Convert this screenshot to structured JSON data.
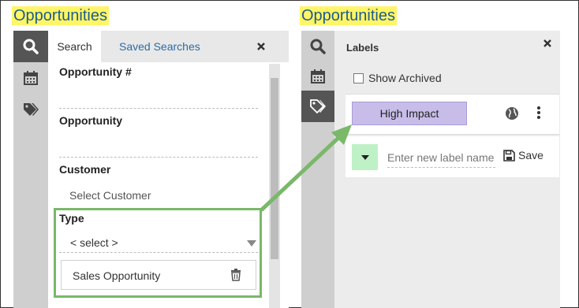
{
  "colors": {
    "heading_bg": "#fff566",
    "heading_text": "#1f5c8b",
    "highlight_green": "#7ab86a",
    "label_purple": "#c8bde8",
    "color_picker_green": "#bff1c6",
    "link_blue": "#2b6ca8"
  },
  "left": {
    "heading": "Opportunities",
    "rail": [
      {
        "icon": "search-icon",
        "active": true
      },
      {
        "icon": "calendar-icon",
        "active": false
      },
      {
        "icon": "tags-icon",
        "active": false
      }
    ],
    "tabs": {
      "search": "Search",
      "saved": "Saved Searches",
      "close_icon": "close-icon"
    },
    "fields": {
      "opportunity_number": "Opportunity #",
      "opportunity": "Opportunity",
      "customer": "Customer",
      "customer_placeholder": "Select Customer",
      "type": "Type",
      "type_selected": "< select >",
      "type_chip": "Sales Opportunity"
    }
  },
  "right": {
    "heading": "Opportunities",
    "rail": [
      {
        "icon": "search-icon",
        "active": false
      },
      {
        "icon": "calendar-icon",
        "active": false
      },
      {
        "icon": "tags-icon",
        "active": true
      }
    ],
    "title": "Labels",
    "show_archived": "Show Archived",
    "label_name": "High Impact",
    "new_label_placeholder": "Enter new label name",
    "save": "Save"
  }
}
